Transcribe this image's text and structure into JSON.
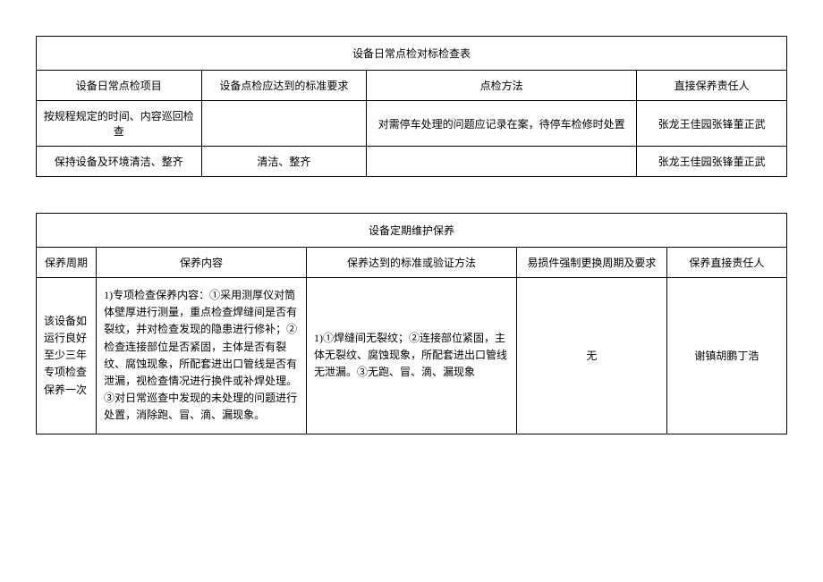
{
  "table1": {
    "title": "设备日常点检对标检查表",
    "headers": [
      "设备日常点检项目",
      "设备点检应达到的标准要求",
      "点检方法",
      "直接保养责任人"
    ],
    "rows": [
      {
        "c0": "按规程规定的时间、内容巡回检查",
        "c1": "",
        "c2": "对需停车处理的问题应记录在案，待停车检修时处置",
        "c3": "张龙王佳园张锋董正武"
      },
      {
        "c0": "保持设备及环境清洁、整齐",
        "c1": "清洁、整齐",
        "c2": "",
        "c3": "张龙王佳园张锋董正武"
      }
    ]
  },
  "table2": {
    "title": "设备定期维护保养",
    "headers": [
      "保养周期",
      "保养内容",
      "保养达到的标准或验证方法",
      "易损件强制更换周期及要求",
      "保养直接责任人"
    ],
    "rows": [
      {
        "c0": "该设备如运行良好至少三年专项检查保养一次",
        "c1": "1)专项检查保养内容：①采用测厚仪对筒体壁厚进行测量，重点检查焊缝间是否有裂纹，并对检查发现的隐患进行修补；②检查连接部位是否紧固，主体是否有裂纹、腐蚀现象，所配套进出口管线是否有泄漏，视检查情况进行换件或补焊处理。③对日常巡查中发现的未处理的问题进行处置，消除跑、冒、滴、漏现象。",
        "c2": "1)①焊缝间无裂纹；②连接部位紧固，主体无裂纹、腐蚀现象，所配套进出口管线无泄漏。③无跑、冒、滴、漏现象",
        "c3": "无",
        "c4": "谢镇胡鹏丁浩"
      }
    ]
  }
}
